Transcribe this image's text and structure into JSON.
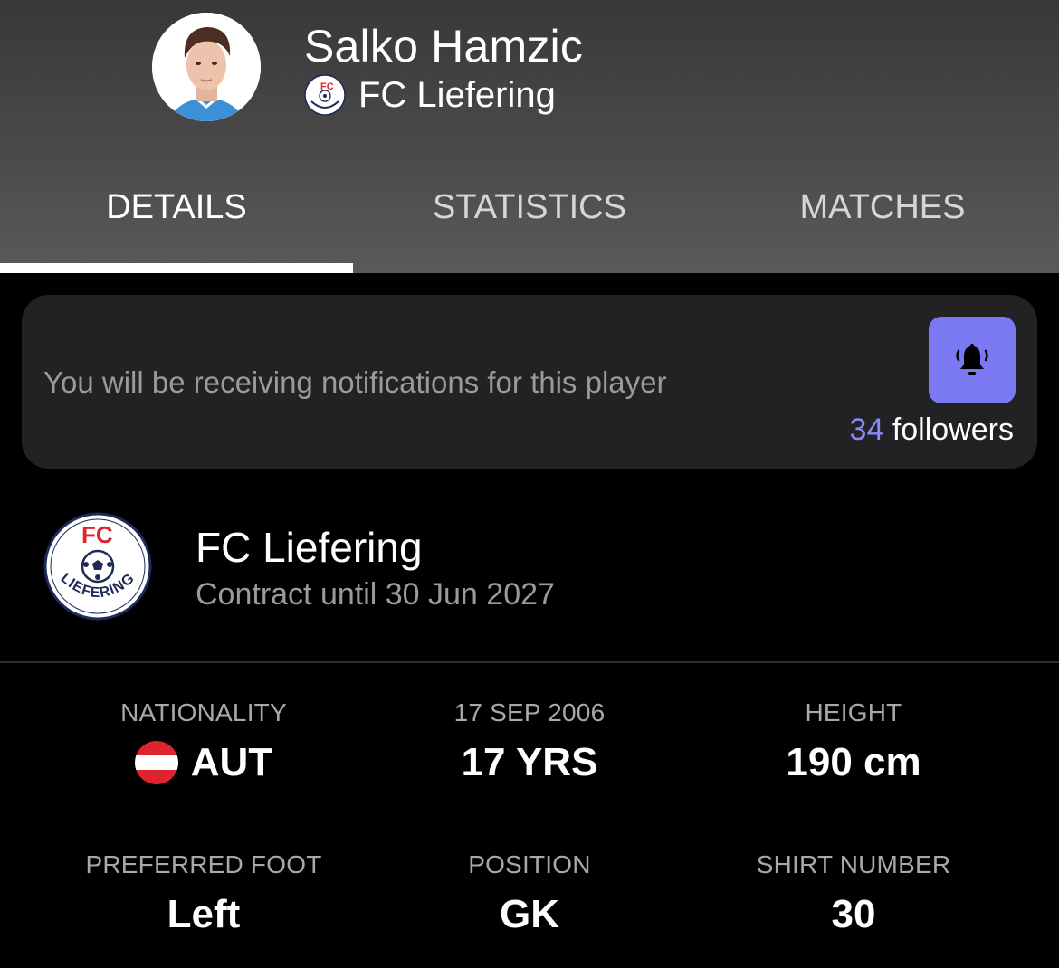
{
  "player": {
    "name": "Salko Hamzic",
    "club": "FC Liefering"
  },
  "tabs": [
    {
      "label": "DETAILS",
      "active": true
    },
    {
      "label": "STATISTICS",
      "active": false
    },
    {
      "label": "MATCHES",
      "active": false
    }
  ],
  "notification": {
    "message": "You will be receiving notifications for this player",
    "followers_count": "34",
    "followers_label": "followers",
    "icon": "bell-ringing-icon"
  },
  "club_card": {
    "name": "FC Liefering",
    "contract": "Contract until 30 Jun 2027",
    "crest_text_top": "FC",
    "crest_text_bottom": "LIEFERING"
  },
  "details": [
    {
      "label": "NATIONALITY",
      "value": "AUT",
      "flag": "austria-flag-icon"
    },
    {
      "label": "17 SEP 2006",
      "value": "17 YRS"
    },
    {
      "label": "HEIGHT",
      "value": "190 cm"
    },
    {
      "label": "PREFERRED FOOT",
      "value": "Left"
    },
    {
      "label": "POSITION",
      "value": "GK"
    },
    {
      "label": "SHIRT NUMBER",
      "value": "30"
    }
  ],
  "colors": {
    "accent": "#7b79f2",
    "followers_count": "#8b88ff",
    "crest_red": "#e0242f",
    "crest_navy": "#1d2a5a",
    "flag_red": "#e0242f"
  }
}
